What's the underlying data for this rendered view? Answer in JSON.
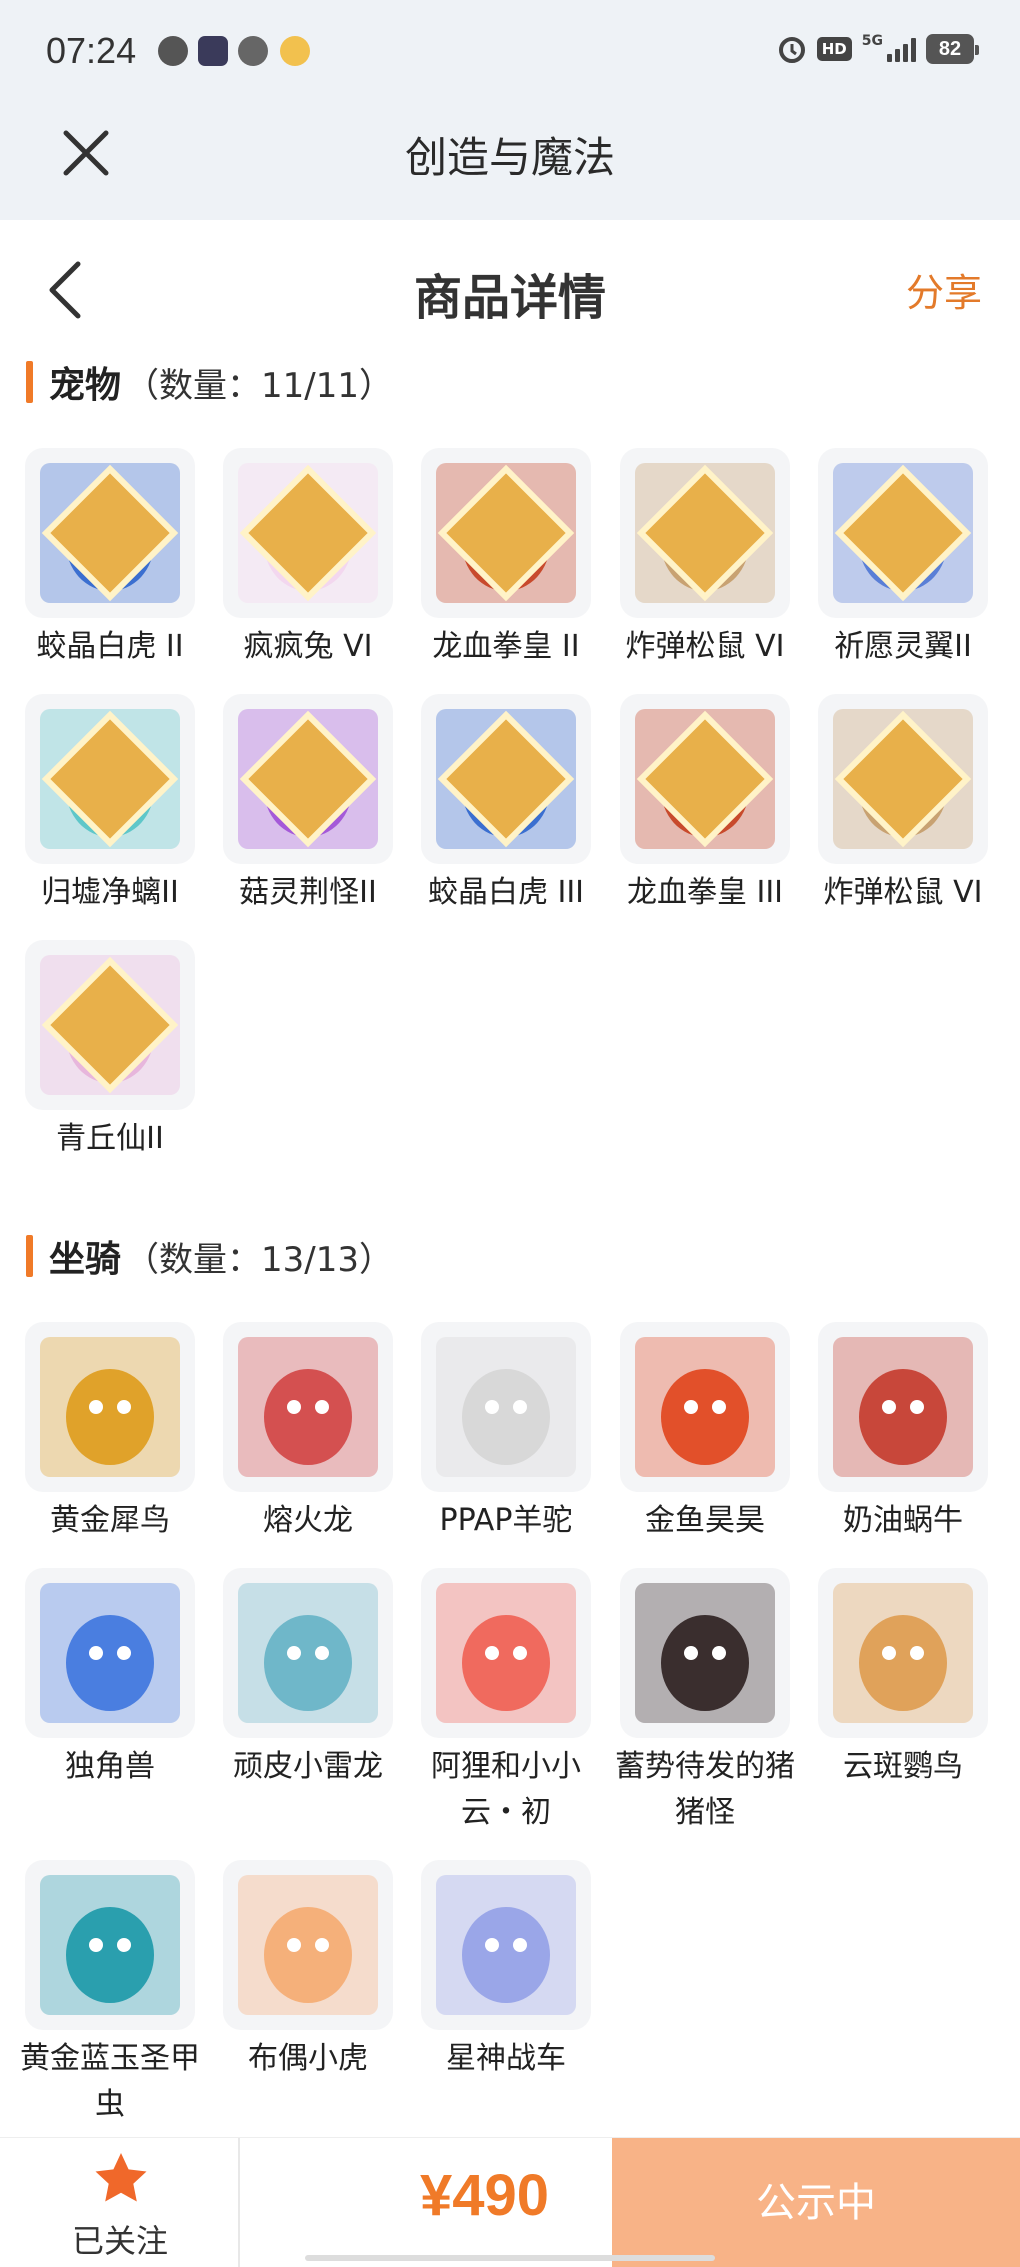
{
  "status_bar": {
    "time": "07:24",
    "network": "5G",
    "hd": "HD",
    "battery": "82"
  },
  "app_header": {
    "title": "创造与魔法"
  },
  "nav": {
    "title": "商品详情",
    "share_label": "分享"
  },
  "pets": {
    "name": "宠物",
    "count": "（数量：11/11）",
    "items": [
      {
        "label": "蛟晶白虎 II",
        "color": "#3b6fd0",
        "badge": "II"
      },
      {
        "label": "疯疯兔 VI",
        "color": "#f3d7ef",
        "badge": "VI"
      },
      {
        "label": "龙血拳皇 II",
        "color": "#c84a2c",
        "badge": "II"
      },
      {
        "label": "炸弹松鼠 VI",
        "color": "#c8a272",
        "badge": "VI"
      },
      {
        "label": "祈愿灵翼II",
        "color": "#5a7fd6",
        "badge": "II"
      },
      {
        "label": "归墟净螭II",
        "color": "#5fc7c9",
        "badge": "II"
      },
      {
        "label": "菇灵荆怪II",
        "color": "#a55ad8",
        "badge": "II"
      },
      {
        "label": "蛟晶白虎 III",
        "color": "#3b6fd0",
        "badge": "III"
      },
      {
        "label": "龙血拳皇 III",
        "color": "#c84a2c",
        "badge": "III"
      },
      {
        "label": "炸弹松鼠 VI",
        "color": "#c8a272",
        "badge": "VI"
      },
      {
        "label": "青丘仙II",
        "color": "#e7b6dc",
        "badge": "II"
      }
    ]
  },
  "mounts": {
    "name": "坐骑",
    "count": "（数量：13/13）",
    "items": [
      {
        "label": "黄金犀鸟",
        "color": "#e0a22a"
      },
      {
        "label": "熔火龙",
        "color": "#d45050"
      },
      {
        "label": "PPAP羊驼",
        "color": "#d8d8d8"
      },
      {
        "label": "金鱼昊昊",
        "color": "#e2502a"
      },
      {
        "label": "奶油蜗牛",
        "color": "#c8473a"
      },
      {
        "label": "独角兽",
        "color": "#4a7ee0"
      },
      {
        "label": "顽皮小雷龙",
        "color": "#6fb7c9"
      },
      {
        "label": "阿狸和小小云・初",
        "color": "#f06a5e"
      },
      {
        "label": "蓄势待发的猪猪怪",
        "color": "#3a2e2e"
      },
      {
        "label": "云斑鹦鸟",
        "color": "#e0a25a"
      },
      {
        "label": "黄金蓝玉圣甲虫",
        "color": "#2a9fae"
      },
      {
        "label": "布偶小虎",
        "color": "#f5b07a"
      },
      {
        "label": "星神战车",
        "color": "#9aa6e8"
      }
    ]
  },
  "bottom": {
    "follow_label": "已关注",
    "price": "¥490",
    "status_label": "公示中"
  },
  "colors": {
    "accent": "#f07a28",
    "button_bg": "#f8b387"
  }
}
